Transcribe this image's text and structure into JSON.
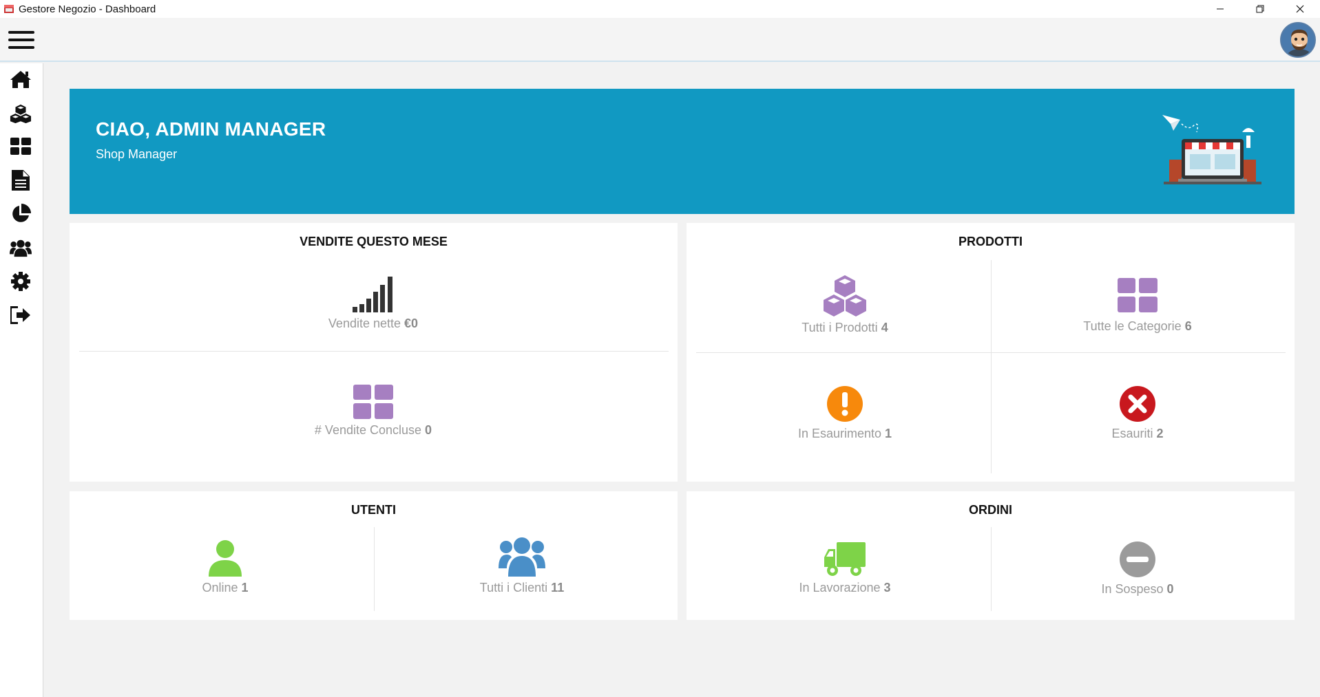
{
  "window": {
    "title": "Gestore Negozio - Dashboard"
  },
  "sidebar": {
    "items": [
      {
        "name": "home-icon"
      },
      {
        "name": "cubes-icon"
      },
      {
        "name": "th-large-icon"
      },
      {
        "name": "file-text-icon"
      },
      {
        "name": "pie-chart-icon"
      },
      {
        "name": "users-icon"
      },
      {
        "name": "gear-icon"
      },
      {
        "name": "sign-out-icon"
      }
    ]
  },
  "banner": {
    "greeting": "CIAO, ADMIN MANAGER",
    "role": "Shop Manager",
    "background": "#1199c2"
  },
  "sales": {
    "title": "VENDITE QUESTO MESE",
    "net_label": "Vendite nette",
    "net_value": "€0",
    "closed_label": "# Vendite Concluse",
    "closed_value": "0"
  },
  "products": {
    "title": "PRODOTTI",
    "all_label": "Tutti i Prodotti",
    "all_value": "4",
    "categories_label": "Tutte le Categorie",
    "categories_value": "6",
    "low_label": "In Esaurimento",
    "low_value": "1",
    "out_label": "Esauriti",
    "out_value": "2"
  },
  "users": {
    "title": "UTENTI",
    "online_label": "Online",
    "online_value": "1",
    "clients_label": "Tutti i Clienti",
    "clients_value": "11"
  },
  "orders": {
    "title": "ORDINI",
    "processing_label": "In Lavorazione",
    "processing_value": "3",
    "pending_label": "In Sospeso",
    "pending_value": "0"
  },
  "colors": {
    "purple": "#a67fc1",
    "orange": "#f7890c",
    "red": "#c8181e",
    "green": "#7ed348",
    "blue": "#4a8fc8",
    "grey": "#9b9b9b",
    "dark": "#333333"
  }
}
